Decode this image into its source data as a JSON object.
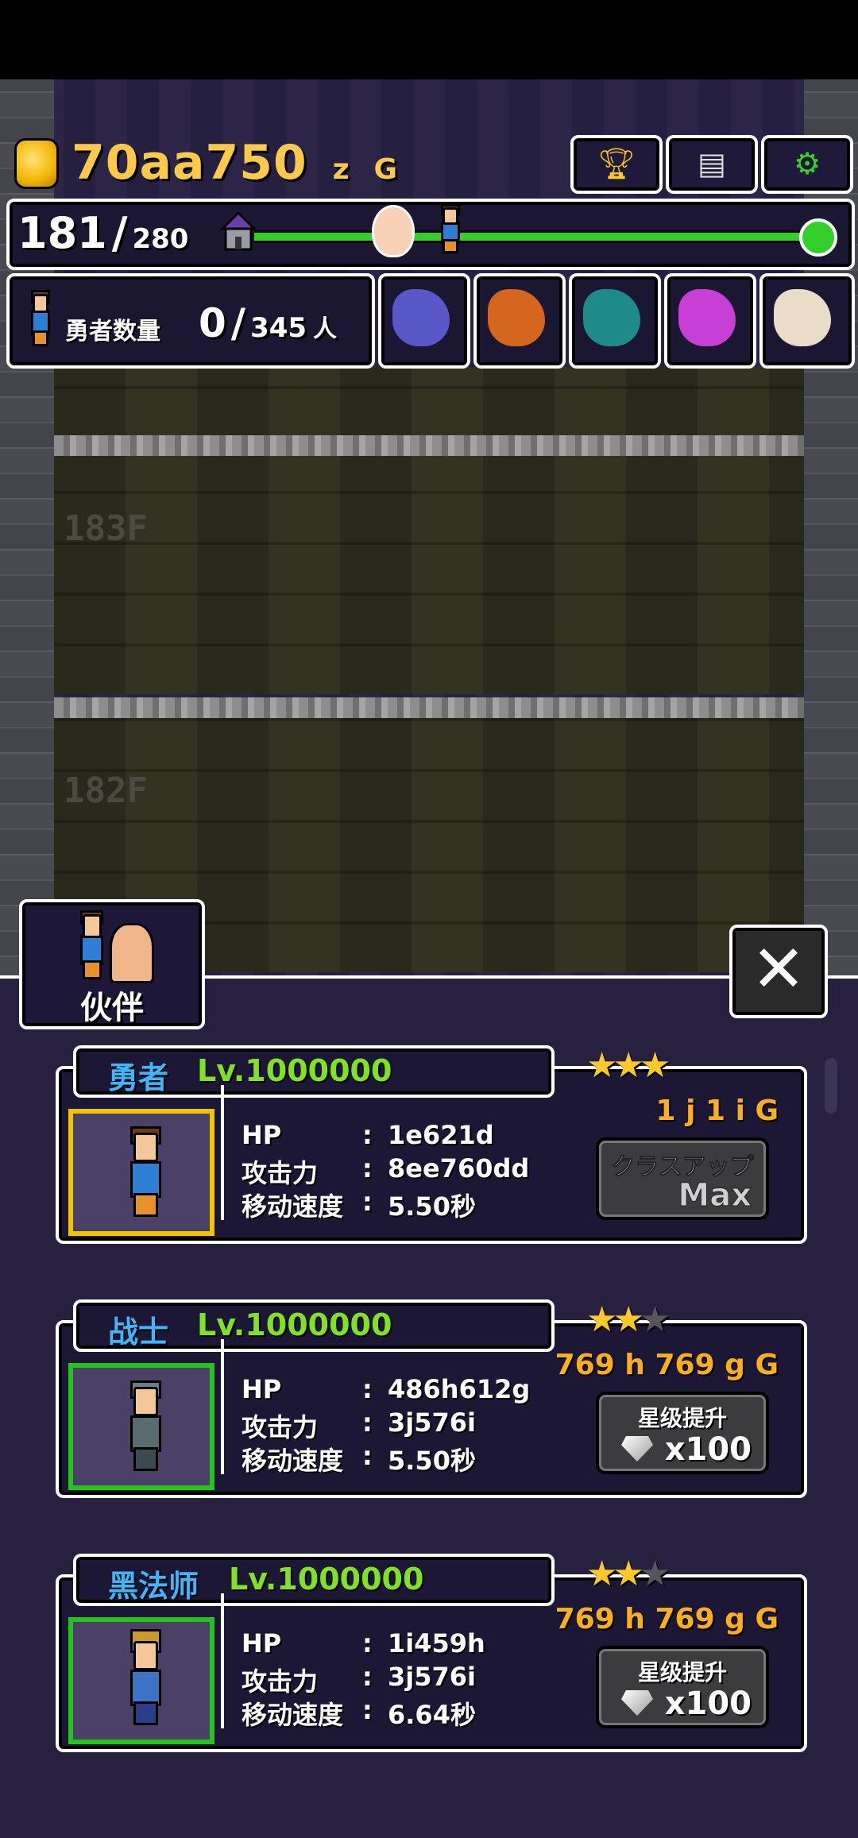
{
  "hud": {
    "gold": {
      "main": "70aa750",
      "suffix": "z",
      "unit": "G"
    },
    "floor_progress": {
      "current": "181",
      "slash": "/",
      "max": "280",
      "fraction": 0.646
    },
    "hero_count": {
      "label": "勇者数量",
      "current": "0",
      "slash": "/",
      "max": "345",
      "unit": "人"
    }
  },
  "dungeon": {
    "floors": [
      {
        "label": "183F"
      },
      {
        "label": "182F"
      }
    ]
  },
  "party_tab": {
    "label": "伙伴"
  },
  "heroes": [
    {
      "name": "勇者",
      "level": "Lv.1000000",
      "stats": [
        {
          "label": "HP",
          "value": "1e621d"
        },
        {
          "label": "攻击力",
          "value": "8ee760dd"
        },
        {
          "label": "移动速度",
          "value": "5.50秒"
        }
      ],
      "stars": 3,
      "stars_max": 3,
      "cost": "1 j 1 i G",
      "action": {
        "top": "クラスアップ",
        "bottom": "Max"
      },
      "frame_color": "#f2c400"
    },
    {
      "name": "战士",
      "level": "Lv.1000000",
      "stats": [
        {
          "label": "HP",
          "value": "486h612g"
        },
        {
          "label": "攻击力",
          "value": "3j576i"
        },
        {
          "label": "移动速度",
          "value": "5.50秒"
        }
      ],
      "stars": 2,
      "stars_max": 3,
      "cost": "769 h 769 g G",
      "action": {
        "top": "星级提升",
        "bottom": "x100"
      },
      "frame_color": "#23c41d"
    },
    {
      "name": "黑法师",
      "level": "Lv.1000000",
      "stats": [
        {
          "label": "HP",
          "value": "1i459h"
        },
        {
          "label": "攻击力",
          "value": "3j576i"
        },
        {
          "label": "移动速度",
          "value": "6.64秒"
        }
      ],
      "stars": 2,
      "stars_max": 3,
      "cost": "769 h 769 g G",
      "action": {
        "top": "星级提升",
        "bottom": "x100"
      },
      "frame_color": "#23c41d"
    }
  ],
  "colors": {
    "gold": "#ffc94a",
    "name": "#3fb6ff",
    "level": "#7fe31f",
    "progress": "#34d02a"
  },
  "icons": [
    "trophy-icon",
    "document-icon",
    "gear-icon",
    "close-icon",
    "diamond-icon",
    "coin-icon"
  ]
}
